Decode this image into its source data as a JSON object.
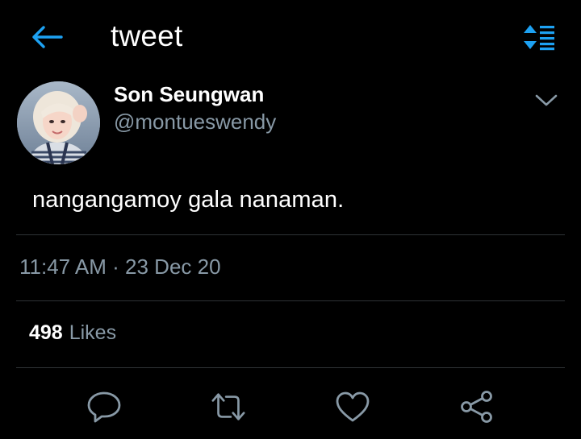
{
  "header": {
    "title": "tweet",
    "back_icon": "arrow-left-icon",
    "sort_icon": "sort-icon",
    "accent_color": "#1da1f2"
  },
  "tweet": {
    "display_name": "Son Seungwan",
    "username": "@montueswendy",
    "text": "nangangamoy gala nanaman.",
    "timestamp": "11:47 AM · 23 Dec 20",
    "likes_count": "498",
    "likes_label": "Likes",
    "avatar_icon": "avatar-photo",
    "menu_icon": "chevron-down-icon"
  },
  "actions": [
    {
      "name": "reply",
      "icon": "reply-icon"
    },
    {
      "name": "retweet",
      "icon": "retweet-icon"
    },
    {
      "name": "like",
      "icon": "heart-icon"
    },
    {
      "name": "share",
      "icon": "share-icon"
    }
  ],
  "colors": {
    "background": "#000000",
    "text_primary": "#ffffff",
    "text_secondary": "#8899a6",
    "divider": "#2f3336",
    "icon_gray": "#8899a6"
  }
}
